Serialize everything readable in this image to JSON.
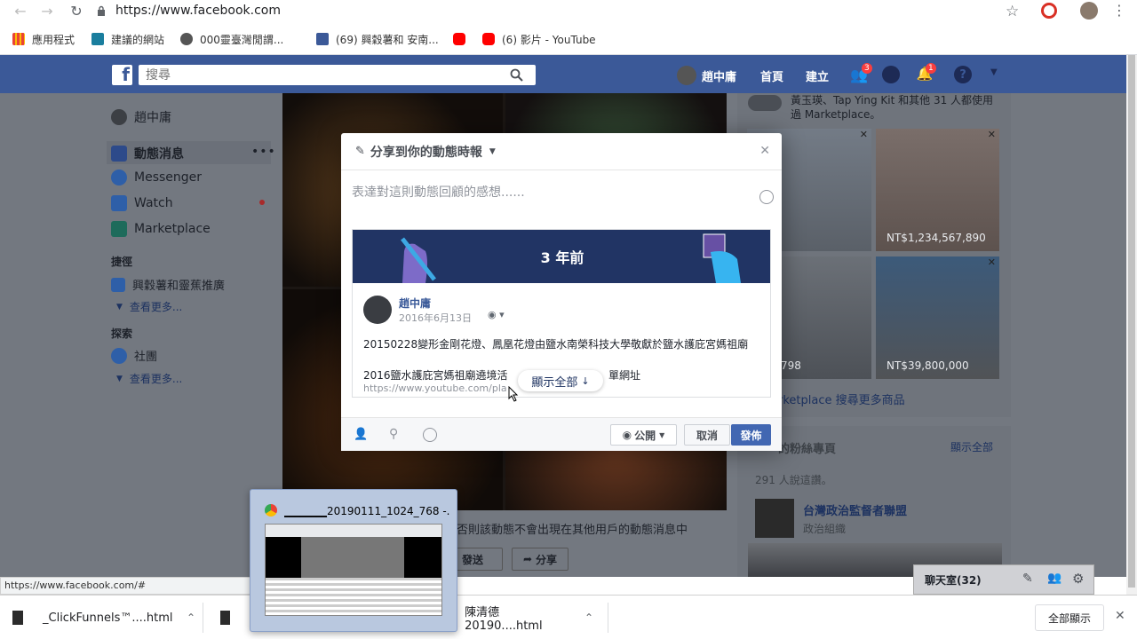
{
  "browser": {
    "url": "https://www.facebook.com",
    "bookmarks": [
      {
        "label": "應用程式",
        "color": "#4285f4"
      },
      {
        "label": "建議的網站",
        "color": "#1a7e9e"
      },
      {
        "label": "000靈臺灣閒謂...",
        "color": "#555555"
      },
      {
        "label": "(69) 興穀薯和 安南...",
        "color": "#3b5998"
      },
      {
        "label": "",
        "color": "#ff0000"
      },
      {
        "label": "(6) 影片 - YouTube",
        "color": "#ff0000"
      }
    ]
  },
  "fb": {
    "search_placeholder": "搜尋",
    "user_name": "趙中庸",
    "home": "首頁",
    "create": "建立",
    "friend_badge": "3",
    "notif_badge": "1"
  },
  "left": {
    "user": "趙中庸",
    "news_feed": "動態消息",
    "messenger": "Messenger",
    "watch": "Watch",
    "marketplace": "Marketplace",
    "shortcuts_title": "捷徑",
    "shortcut1": "興穀薯和靈蕉推廣",
    "see_more1": "查看更多...",
    "explore_title": "探索",
    "groups": "社團",
    "see_more2": "查看更多..."
  },
  "right": {
    "mp_top_text": "黃玉瑛、Tap Ying Kit 和其他 31 人都使用過 Marketplace。",
    "price1": "NT$1,234,567,890",
    "price2": "798",
    "price3": "NT$39,800,000",
    "mp_search": "rketplace 搜尋更多商品",
    "fan_pages": "的粉絲專頁",
    "see_all": "顯示全部",
    "likes": "291 人說這讚。",
    "page_name": "台灣政治監督者聯盟",
    "page_cat": "政治組織"
  },
  "feed": {
    "notice": "否則該動態不會出現在其他用戶的動態消息中",
    "share_btn": "發送",
    "share2": "分享"
  },
  "modal": {
    "title": "分享到你的動態時報",
    "placeholder": "表達對這則動態回顧的感想......",
    "banner": "3 年前",
    "author": "趙中庸",
    "date": "2016年6月13日",
    "text1": "20150228變形金剛花燈、鳳凰花燈由鹽水南榮科技大學敬獻於鹽水護庇宮媽祖廟",
    "text2": "2016鹽水護庇宮媽祖廟遶境活",
    "text2b": "單網址",
    "link": "https://www.youtube.com/pla",
    "show_all": "顯示全部",
    "privacy": "公開",
    "cancel": "取消",
    "post": "發佈"
  },
  "chat": {
    "label": "聊天室(32)"
  },
  "status_url": "https://www.facebook.com/#",
  "downloads": {
    "item1": "_ClickFunnels™....html",
    "item2": "陳清德20190....html",
    "show_all": "全部顯示"
  },
  "taskbar_preview": {
    "title": "20190111_1024_768 -..."
  }
}
